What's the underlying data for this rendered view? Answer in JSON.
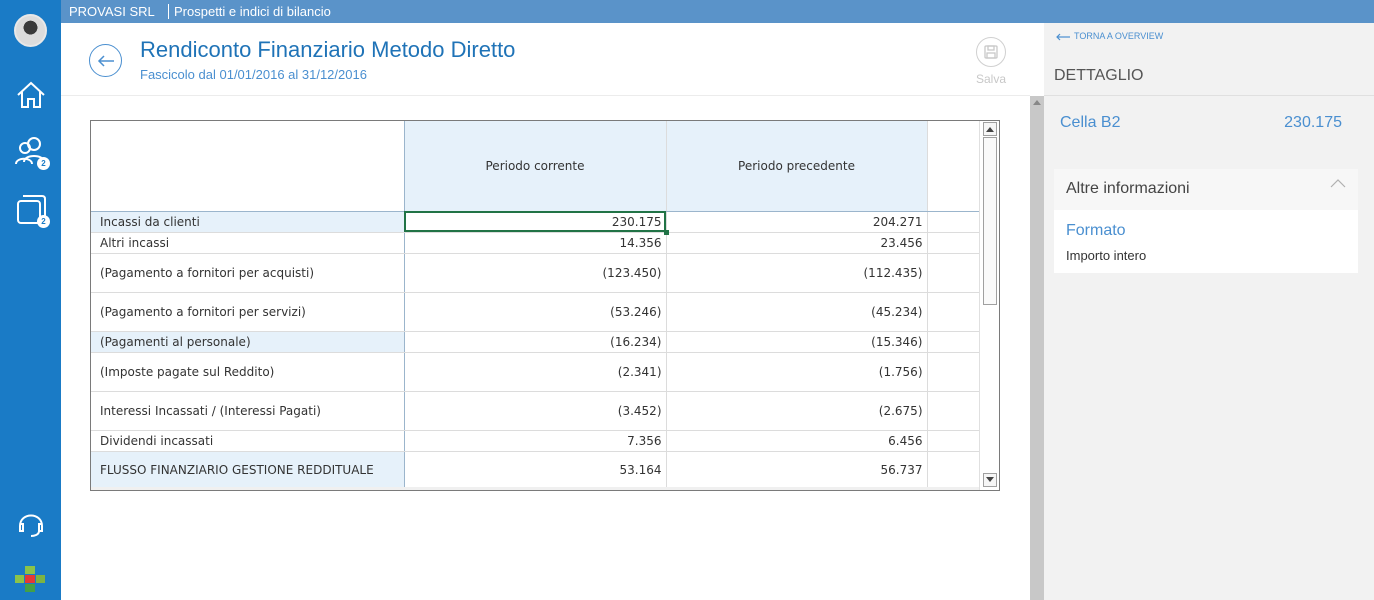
{
  "topbar": {
    "company": "PROVASI SRL",
    "title": "Prospetti e indici di bilancio"
  },
  "header": {
    "title": "Rendiconto Finanziario Metodo Diretto",
    "subtitle": "Fascicolo dal 01/01/2016 al 31/12/2016",
    "save_label": "Salva"
  },
  "rail": {
    "users_badge": "2",
    "windows_badge": "2"
  },
  "grid": {
    "columns": [
      "",
      "Periodo corrente",
      "Periodo precedente"
    ],
    "rows": [
      {
        "label": "Incassi da clienti",
        "current": "230.175",
        "previous": "204.271"
      },
      {
        "label": "Altri incassi",
        "current": "14.356",
        "previous": "23.456"
      },
      {
        "label": "(Pagamento a fornitori per acquisti)",
        "current": "(123.450)",
        "previous": "(112.435)"
      },
      {
        "label": "(Pagamento a fornitori per servizi)",
        "current": "(53.246)",
        "previous": "(45.234)"
      },
      {
        "label": "(Pagamenti al personale)",
        "current": "(16.234)",
        "previous": "(15.346)"
      },
      {
        "label": "(Imposte pagate sul Reddito)",
        "current": "(2.341)",
        "previous": "(1.756)"
      },
      {
        "label": "Interessi Incassati / (Interessi Pagati)",
        "current": "(3.452)",
        "previous": "(2.675)"
      },
      {
        "label": "Dividendi incassati",
        "current": "7.356",
        "previous": "6.456"
      },
      {
        "label": "FLUSSO FINANZIARIO GESTIONE REDDITUALE",
        "current": "53.164",
        "previous": "56.737"
      }
    ]
  },
  "panel": {
    "back_label": "TORNA A OVERVIEW",
    "heading": "DETTAGLIO",
    "cell_name": "Cella B2",
    "cell_value": "230.175",
    "card_title": "Altre informazioni",
    "format_label": "Formato",
    "format_value": "Importo intero"
  },
  "colors": {
    "rail": "#1a7bc6",
    "topbar": "#5a93c9",
    "accent": "#1f73b7",
    "selection": "#217346"
  }
}
